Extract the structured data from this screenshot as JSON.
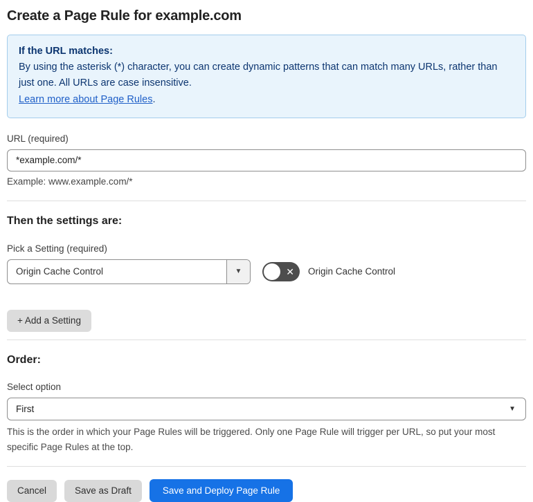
{
  "page": {
    "title": "Create a Page Rule for example.com"
  },
  "info_box": {
    "heading": "If the URL matches:",
    "body": "By using the asterisk (*) character, you can create dynamic patterns that can match many URLs, rather than just one. All URLs are case insensitive.",
    "link_label": "Learn more about Page Rules",
    "link_suffix": "."
  },
  "url_section": {
    "label": "URL (required)",
    "input_value": "*example.com/*",
    "helper": "Example: www.example.com/*"
  },
  "settings_section": {
    "heading": "Then the settings are:",
    "setting_label": "Pick a Setting (required)",
    "setting_value": "Origin Cache Control",
    "toggle_label": "Origin Cache Control",
    "toggle_glyph": "✕",
    "add_button_label": "+ Add a Setting"
  },
  "order_section": {
    "heading": "Order:",
    "select_label": "Select option",
    "select_value": "First",
    "helper": "This is the order in which your Page Rules will be triggered. Only one Page Rule will trigger per URL, so put your most specific Page Rules at the top."
  },
  "footer": {
    "cancel_label": "Cancel",
    "save_draft_label": "Save as Draft",
    "save_deploy_label": "Save and Deploy Page Rule"
  },
  "icons": {
    "dropdown_arrow": "▼"
  },
  "colors": {
    "primary_button": "#1672e6",
    "info_background": "#e9f4fc",
    "info_border": "#a3cdec",
    "info_text": "#0c3570",
    "link": "#2060c8",
    "toggle_off": "#4d4d4d",
    "divider": "#dedede"
  }
}
